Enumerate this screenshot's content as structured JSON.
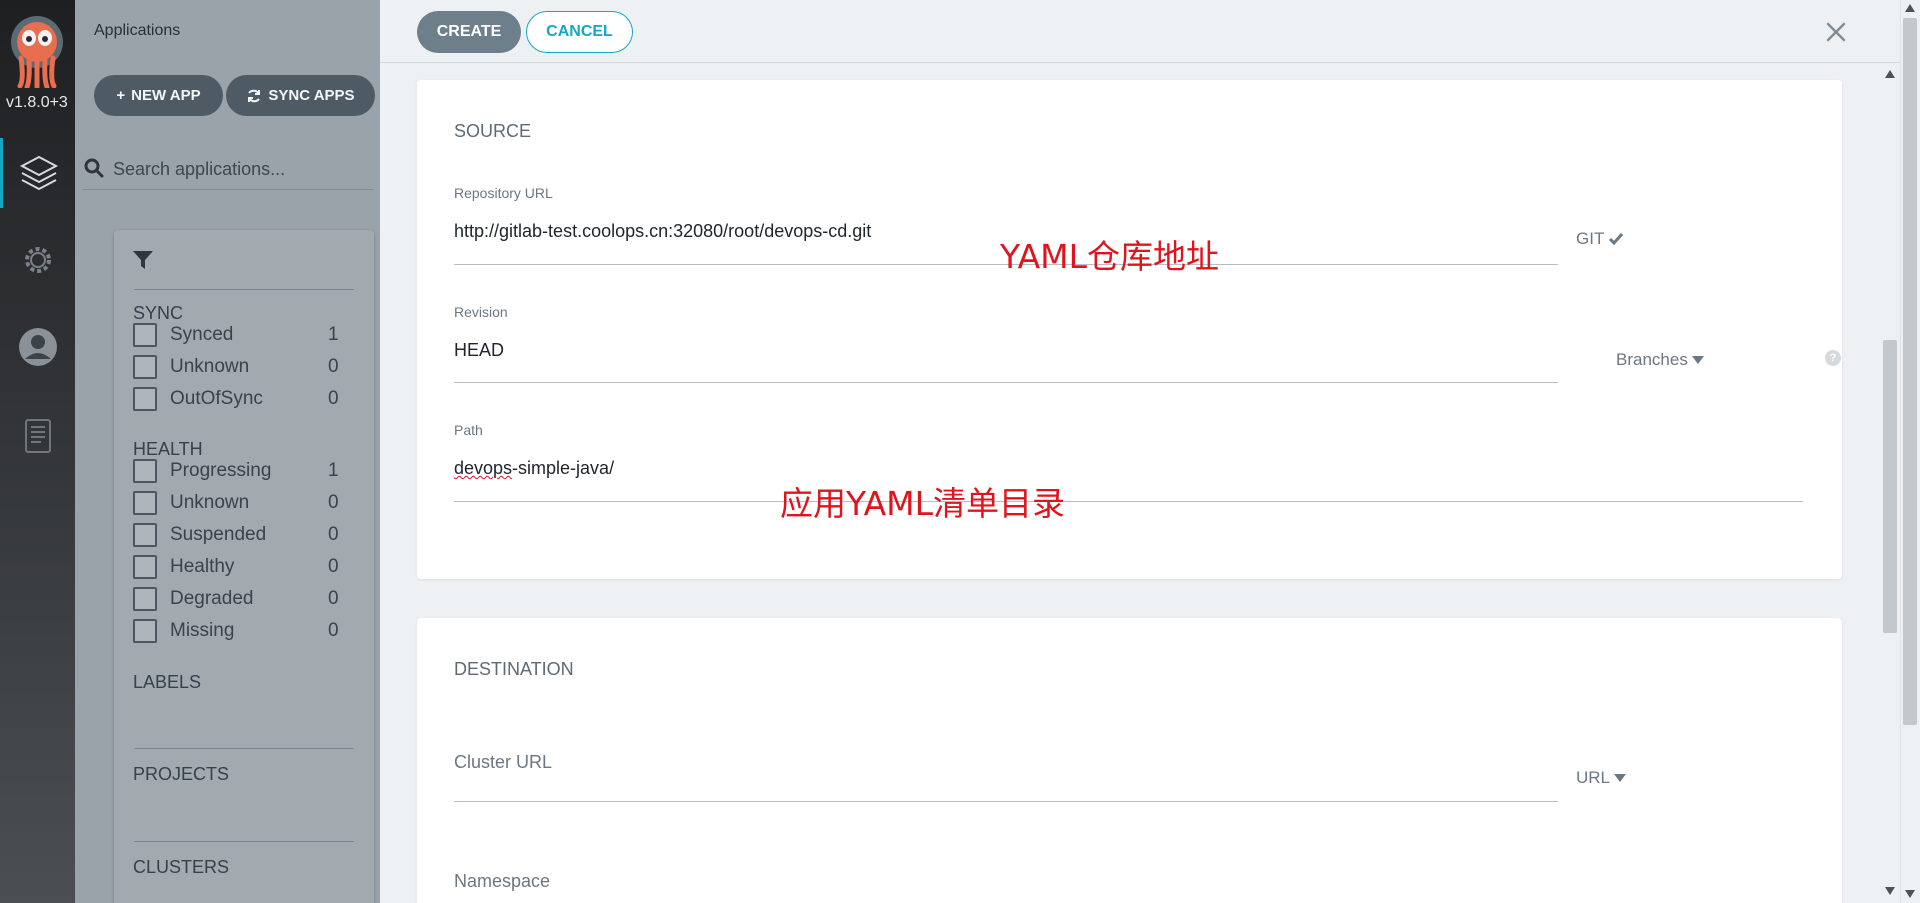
{
  "rail": {
    "version": "v1.8.0+3",
    "items": [
      {
        "icon": "layers-icon"
      },
      {
        "icon": "gear-icon"
      },
      {
        "icon": "user-icon"
      },
      {
        "icon": "docs-icon"
      }
    ],
    "accent": "#14a7c4"
  },
  "panel": {
    "title": "Applications",
    "new_app": "NEW APP",
    "sync_apps": "SYNC APPS",
    "search_placeholder": "Search applications...",
    "sync": {
      "heading": "SYNC",
      "items": [
        {
          "label": "Synced",
          "count": "1"
        },
        {
          "label": "Unknown",
          "count": "0"
        },
        {
          "label": "OutOfSync",
          "count": "0"
        }
      ]
    },
    "health": {
      "heading": "HEALTH",
      "items": [
        {
          "label": "Progressing",
          "count": "1"
        },
        {
          "label": "Unknown",
          "count": "0"
        },
        {
          "label": "Suspended",
          "count": "0"
        },
        {
          "label": "Healthy",
          "count": "0"
        },
        {
          "label": "Degraded",
          "count": "0"
        },
        {
          "label": "Missing",
          "count": "0"
        }
      ]
    },
    "labels_heading": "LABELS",
    "projects_heading": "PROJECTS",
    "clusters_heading": "CLUSTERS"
  },
  "toolbar": {
    "create": "CREATE",
    "cancel": "CANCEL"
  },
  "source": {
    "title": "SOURCE",
    "repo_label": "Repository URL",
    "repo_value": "http://gitlab-test.coolops.cn:32080/root/devops-cd.git",
    "repo_type": "GIT",
    "revision_label": "Revision",
    "revision_value": "HEAD",
    "revision_mode": "Branches",
    "path_label": "Path",
    "path_value_a": "devops",
    "path_value_b": "-simple-java/"
  },
  "destination": {
    "title": "DESTINATION",
    "cluster_placeholder": "Cluster URL",
    "cluster_mode": "URL",
    "namespace_placeholder": "Namespace"
  },
  "annotations": {
    "repo_note": "YAML仓库地址",
    "path_note": "应用YAML清单目录"
  }
}
